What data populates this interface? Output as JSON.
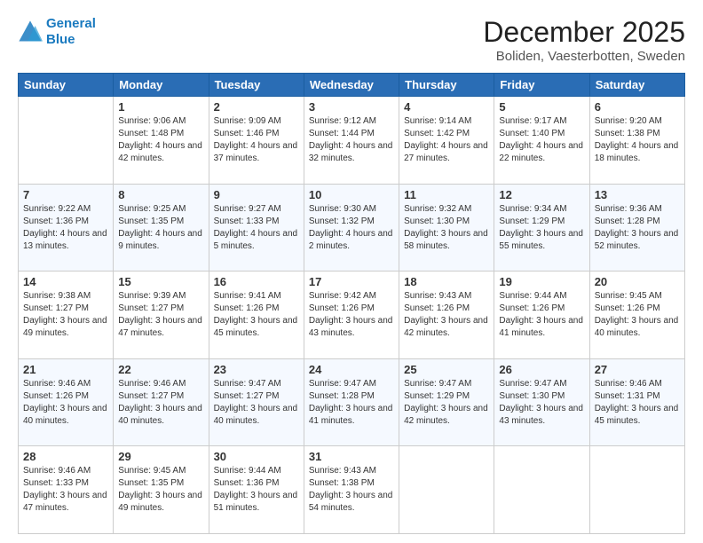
{
  "logo": {
    "line1": "General",
    "line2": "Blue"
  },
  "header": {
    "month": "December 2025",
    "location": "Boliden, Vaesterbotten, Sweden"
  },
  "weekdays": [
    "Sunday",
    "Monday",
    "Tuesday",
    "Wednesday",
    "Thursday",
    "Friday",
    "Saturday"
  ],
  "weeks": [
    [
      {
        "day": "",
        "sunrise": "",
        "sunset": "",
        "daylight": ""
      },
      {
        "day": "1",
        "sunrise": "Sunrise: 9:06 AM",
        "sunset": "Sunset: 1:48 PM",
        "daylight": "Daylight: 4 hours and 42 minutes."
      },
      {
        "day": "2",
        "sunrise": "Sunrise: 9:09 AM",
        "sunset": "Sunset: 1:46 PM",
        "daylight": "Daylight: 4 hours and 37 minutes."
      },
      {
        "day": "3",
        "sunrise": "Sunrise: 9:12 AM",
        "sunset": "Sunset: 1:44 PM",
        "daylight": "Daylight: 4 hours and 32 minutes."
      },
      {
        "day": "4",
        "sunrise": "Sunrise: 9:14 AM",
        "sunset": "Sunset: 1:42 PM",
        "daylight": "Daylight: 4 hours and 27 minutes."
      },
      {
        "day": "5",
        "sunrise": "Sunrise: 9:17 AM",
        "sunset": "Sunset: 1:40 PM",
        "daylight": "Daylight: 4 hours and 22 minutes."
      },
      {
        "day": "6",
        "sunrise": "Sunrise: 9:20 AM",
        "sunset": "Sunset: 1:38 PM",
        "daylight": "Daylight: 4 hours and 18 minutes."
      }
    ],
    [
      {
        "day": "7",
        "sunrise": "Sunrise: 9:22 AM",
        "sunset": "Sunset: 1:36 PM",
        "daylight": "Daylight: 4 hours and 13 minutes."
      },
      {
        "day": "8",
        "sunrise": "Sunrise: 9:25 AM",
        "sunset": "Sunset: 1:35 PM",
        "daylight": "Daylight: 4 hours and 9 minutes."
      },
      {
        "day": "9",
        "sunrise": "Sunrise: 9:27 AM",
        "sunset": "Sunset: 1:33 PM",
        "daylight": "Daylight: 4 hours and 5 minutes."
      },
      {
        "day": "10",
        "sunrise": "Sunrise: 9:30 AM",
        "sunset": "Sunset: 1:32 PM",
        "daylight": "Daylight: 4 hours and 2 minutes."
      },
      {
        "day": "11",
        "sunrise": "Sunrise: 9:32 AM",
        "sunset": "Sunset: 1:30 PM",
        "daylight": "Daylight: 3 hours and 58 minutes."
      },
      {
        "day": "12",
        "sunrise": "Sunrise: 9:34 AM",
        "sunset": "Sunset: 1:29 PM",
        "daylight": "Daylight: 3 hours and 55 minutes."
      },
      {
        "day": "13",
        "sunrise": "Sunrise: 9:36 AM",
        "sunset": "Sunset: 1:28 PM",
        "daylight": "Daylight: 3 hours and 52 minutes."
      }
    ],
    [
      {
        "day": "14",
        "sunrise": "Sunrise: 9:38 AM",
        "sunset": "Sunset: 1:27 PM",
        "daylight": "Daylight: 3 hours and 49 minutes."
      },
      {
        "day": "15",
        "sunrise": "Sunrise: 9:39 AM",
        "sunset": "Sunset: 1:27 PM",
        "daylight": "Daylight: 3 hours and 47 minutes."
      },
      {
        "day": "16",
        "sunrise": "Sunrise: 9:41 AM",
        "sunset": "Sunset: 1:26 PM",
        "daylight": "Daylight: 3 hours and 45 minutes."
      },
      {
        "day": "17",
        "sunrise": "Sunrise: 9:42 AM",
        "sunset": "Sunset: 1:26 PM",
        "daylight": "Daylight: 3 hours and 43 minutes."
      },
      {
        "day": "18",
        "sunrise": "Sunrise: 9:43 AM",
        "sunset": "Sunset: 1:26 PM",
        "daylight": "Daylight: 3 hours and 42 minutes."
      },
      {
        "day": "19",
        "sunrise": "Sunrise: 9:44 AM",
        "sunset": "Sunset: 1:26 PM",
        "daylight": "Daylight: 3 hours and 41 minutes."
      },
      {
        "day": "20",
        "sunrise": "Sunrise: 9:45 AM",
        "sunset": "Sunset: 1:26 PM",
        "daylight": "Daylight: 3 hours and 40 minutes."
      }
    ],
    [
      {
        "day": "21",
        "sunrise": "Sunrise: 9:46 AM",
        "sunset": "Sunset: 1:26 PM",
        "daylight": "Daylight: 3 hours and 40 minutes."
      },
      {
        "day": "22",
        "sunrise": "Sunrise: 9:46 AM",
        "sunset": "Sunset: 1:27 PM",
        "daylight": "Daylight: 3 hours and 40 minutes."
      },
      {
        "day": "23",
        "sunrise": "Sunrise: 9:47 AM",
        "sunset": "Sunset: 1:27 PM",
        "daylight": "Daylight: 3 hours and 40 minutes."
      },
      {
        "day": "24",
        "sunrise": "Sunrise: 9:47 AM",
        "sunset": "Sunset: 1:28 PM",
        "daylight": "Daylight: 3 hours and 41 minutes."
      },
      {
        "day": "25",
        "sunrise": "Sunrise: 9:47 AM",
        "sunset": "Sunset: 1:29 PM",
        "daylight": "Daylight: 3 hours and 42 minutes."
      },
      {
        "day": "26",
        "sunrise": "Sunrise: 9:47 AM",
        "sunset": "Sunset: 1:30 PM",
        "daylight": "Daylight: 3 hours and 43 minutes."
      },
      {
        "day": "27",
        "sunrise": "Sunrise: 9:46 AM",
        "sunset": "Sunset: 1:31 PM",
        "daylight": "Daylight: 3 hours and 45 minutes."
      }
    ],
    [
      {
        "day": "28",
        "sunrise": "Sunrise: 9:46 AM",
        "sunset": "Sunset: 1:33 PM",
        "daylight": "Daylight: 3 hours and 47 minutes."
      },
      {
        "day": "29",
        "sunrise": "Sunrise: 9:45 AM",
        "sunset": "Sunset: 1:35 PM",
        "daylight": "Daylight: 3 hours and 49 minutes."
      },
      {
        "day": "30",
        "sunrise": "Sunrise: 9:44 AM",
        "sunset": "Sunset: 1:36 PM",
        "daylight": "Daylight: 3 hours and 51 minutes."
      },
      {
        "day": "31",
        "sunrise": "Sunrise: 9:43 AM",
        "sunset": "Sunset: 1:38 PM",
        "daylight": "Daylight: 3 hours and 54 minutes."
      },
      {
        "day": "",
        "sunrise": "",
        "sunset": "",
        "daylight": ""
      },
      {
        "day": "",
        "sunrise": "",
        "sunset": "",
        "daylight": ""
      },
      {
        "day": "",
        "sunrise": "",
        "sunset": "",
        "daylight": ""
      }
    ]
  ]
}
